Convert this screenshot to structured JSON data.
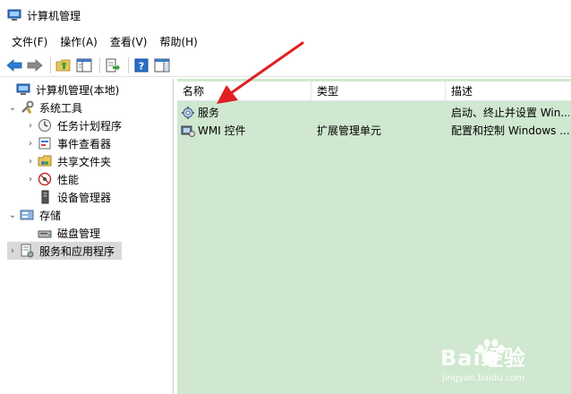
{
  "window": {
    "title": "计算机管理"
  },
  "menu": [
    "文件(F)",
    "操作(A)",
    "查看(V)",
    "帮助(H)"
  ],
  "toolbar": [
    "back-icon",
    "forward-icon",
    "up-folder-icon",
    "show-hide-tree-icon",
    "export-list-icon",
    "help-icon",
    "properties-pane-icon"
  ],
  "tree": [
    {
      "label": "计算机管理(本地)",
      "icon": "computer-management-icon",
      "caret": ""
    },
    {
      "label": "系统工具",
      "icon": "tools-icon",
      "caret": "⌄"
    },
    {
      "label": "任务计划程序",
      "icon": "clock-icon",
      "caret": "›"
    },
    {
      "label": "事件查看器",
      "icon": "event-viewer-icon",
      "caret": "›"
    },
    {
      "label": "共享文件夹",
      "icon": "shared-folder-icon",
      "caret": "›"
    },
    {
      "label": "性能",
      "icon": "performance-icon",
      "caret": "›"
    },
    {
      "label": "设备管理器",
      "icon": "device-manager-icon",
      "caret": ""
    },
    {
      "label": "存储",
      "icon": "storage-icon",
      "caret": "⌄"
    },
    {
      "label": "磁盘管理",
      "icon": "disk-icon",
      "caret": ""
    },
    {
      "label": "服务和应用程序",
      "icon": "services-apps-icon",
      "caret": "›"
    }
  ],
  "list": {
    "columns": [
      "名称",
      "类型",
      "描述"
    ],
    "rows": [
      {
        "name": "服务",
        "type": "",
        "description": "启动、终止并设置 Win...",
        "icon": "gear-services-icon"
      },
      {
        "name": "WMI 控件",
        "type": "扩展管理单元",
        "description": "配置和控制 Windows ...",
        "icon": "wmi-control-icon"
      }
    ]
  },
  "watermark": {
    "brand": "Bai经验",
    "url": "jingyan.baidu.com"
  },
  "colors": {
    "list_background": "#cfe8cf",
    "arrow": "#e02020",
    "selected": "#d9d9d9"
  }
}
